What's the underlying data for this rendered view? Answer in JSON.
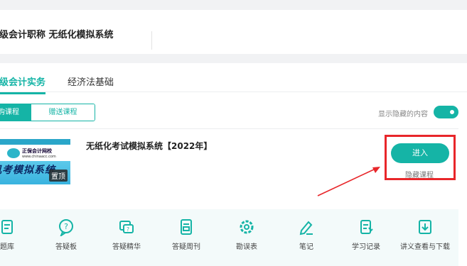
{
  "header": {
    "title": "初级会计职称 无纸化模拟系统"
  },
  "tabs": [
    {
      "label": "初级会计实务",
      "active": true
    },
    {
      "label": "经济法基础",
      "active": false
    }
  ],
  "segment": {
    "purchased": "已购课程",
    "gifted": "赠送课程"
  },
  "show_hidden": {
    "label": "显示隐藏的内容",
    "on": true
  },
  "course": {
    "thumb": {
      "brand": "正保会计网校",
      "url": "www.chinaacc.com",
      "banner": "机考模拟系统",
      "badge": "置顶"
    },
    "title": "无纸化考试模拟系统【2022年】",
    "enter_label": "进入",
    "hide_label": "隐藏课程"
  },
  "tools": [
    {
      "label": "题库",
      "icon": "question-bank-icon"
    },
    {
      "label": "答疑板",
      "icon": "qa-board-icon"
    },
    {
      "label": "答疑精华",
      "icon": "qa-highlights-icon"
    },
    {
      "label": "答疑周刊",
      "icon": "qa-weekly-icon"
    },
    {
      "label": "勘误表",
      "icon": "errata-gear-icon"
    },
    {
      "label": "笔记",
      "icon": "notes-pen-icon"
    },
    {
      "label": "学习记录",
      "icon": "study-record-icon"
    },
    {
      "label": "讲义查看与下载",
      "icon": "handout-download-icon"
    }
  ],
  "colors": {
    "accent": "#15b4a6",
    "highlight": "#e8262a"
  }
}
